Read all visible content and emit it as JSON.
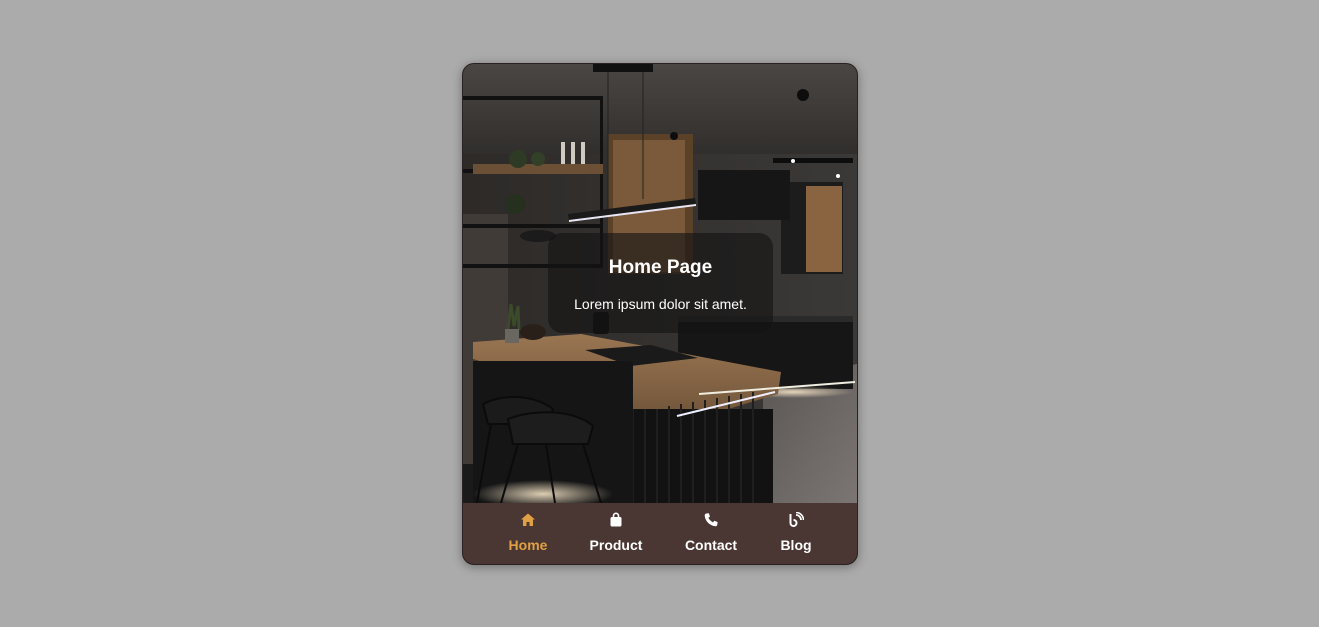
{
  "hero": {
    "title": "Home Page",
    "subtitle": "Lorem ipsum dolor sit amet."
  },
  "nav": {
    "items": [
      {
        "label": "Home",
        "icon": "home-icon",
        "active": true
      },
      {
        "label": "Product",
        "icon": "shopping-bag-icon",
        "active": false
      },
      {
        "label": "Contact",
        "icon": "phone-icon",
        "active": false
      },
      {
        "label": "Blog",
        "icon": "blog-icon",
        "active": false
      }
    ]
  },
  "colors": {
    "page_background": "#ababab",
    "nav_background": "#4a3632",
    "active_accent": "#e0a044",
    "inactive_text": "#ffffff"
  }
}
